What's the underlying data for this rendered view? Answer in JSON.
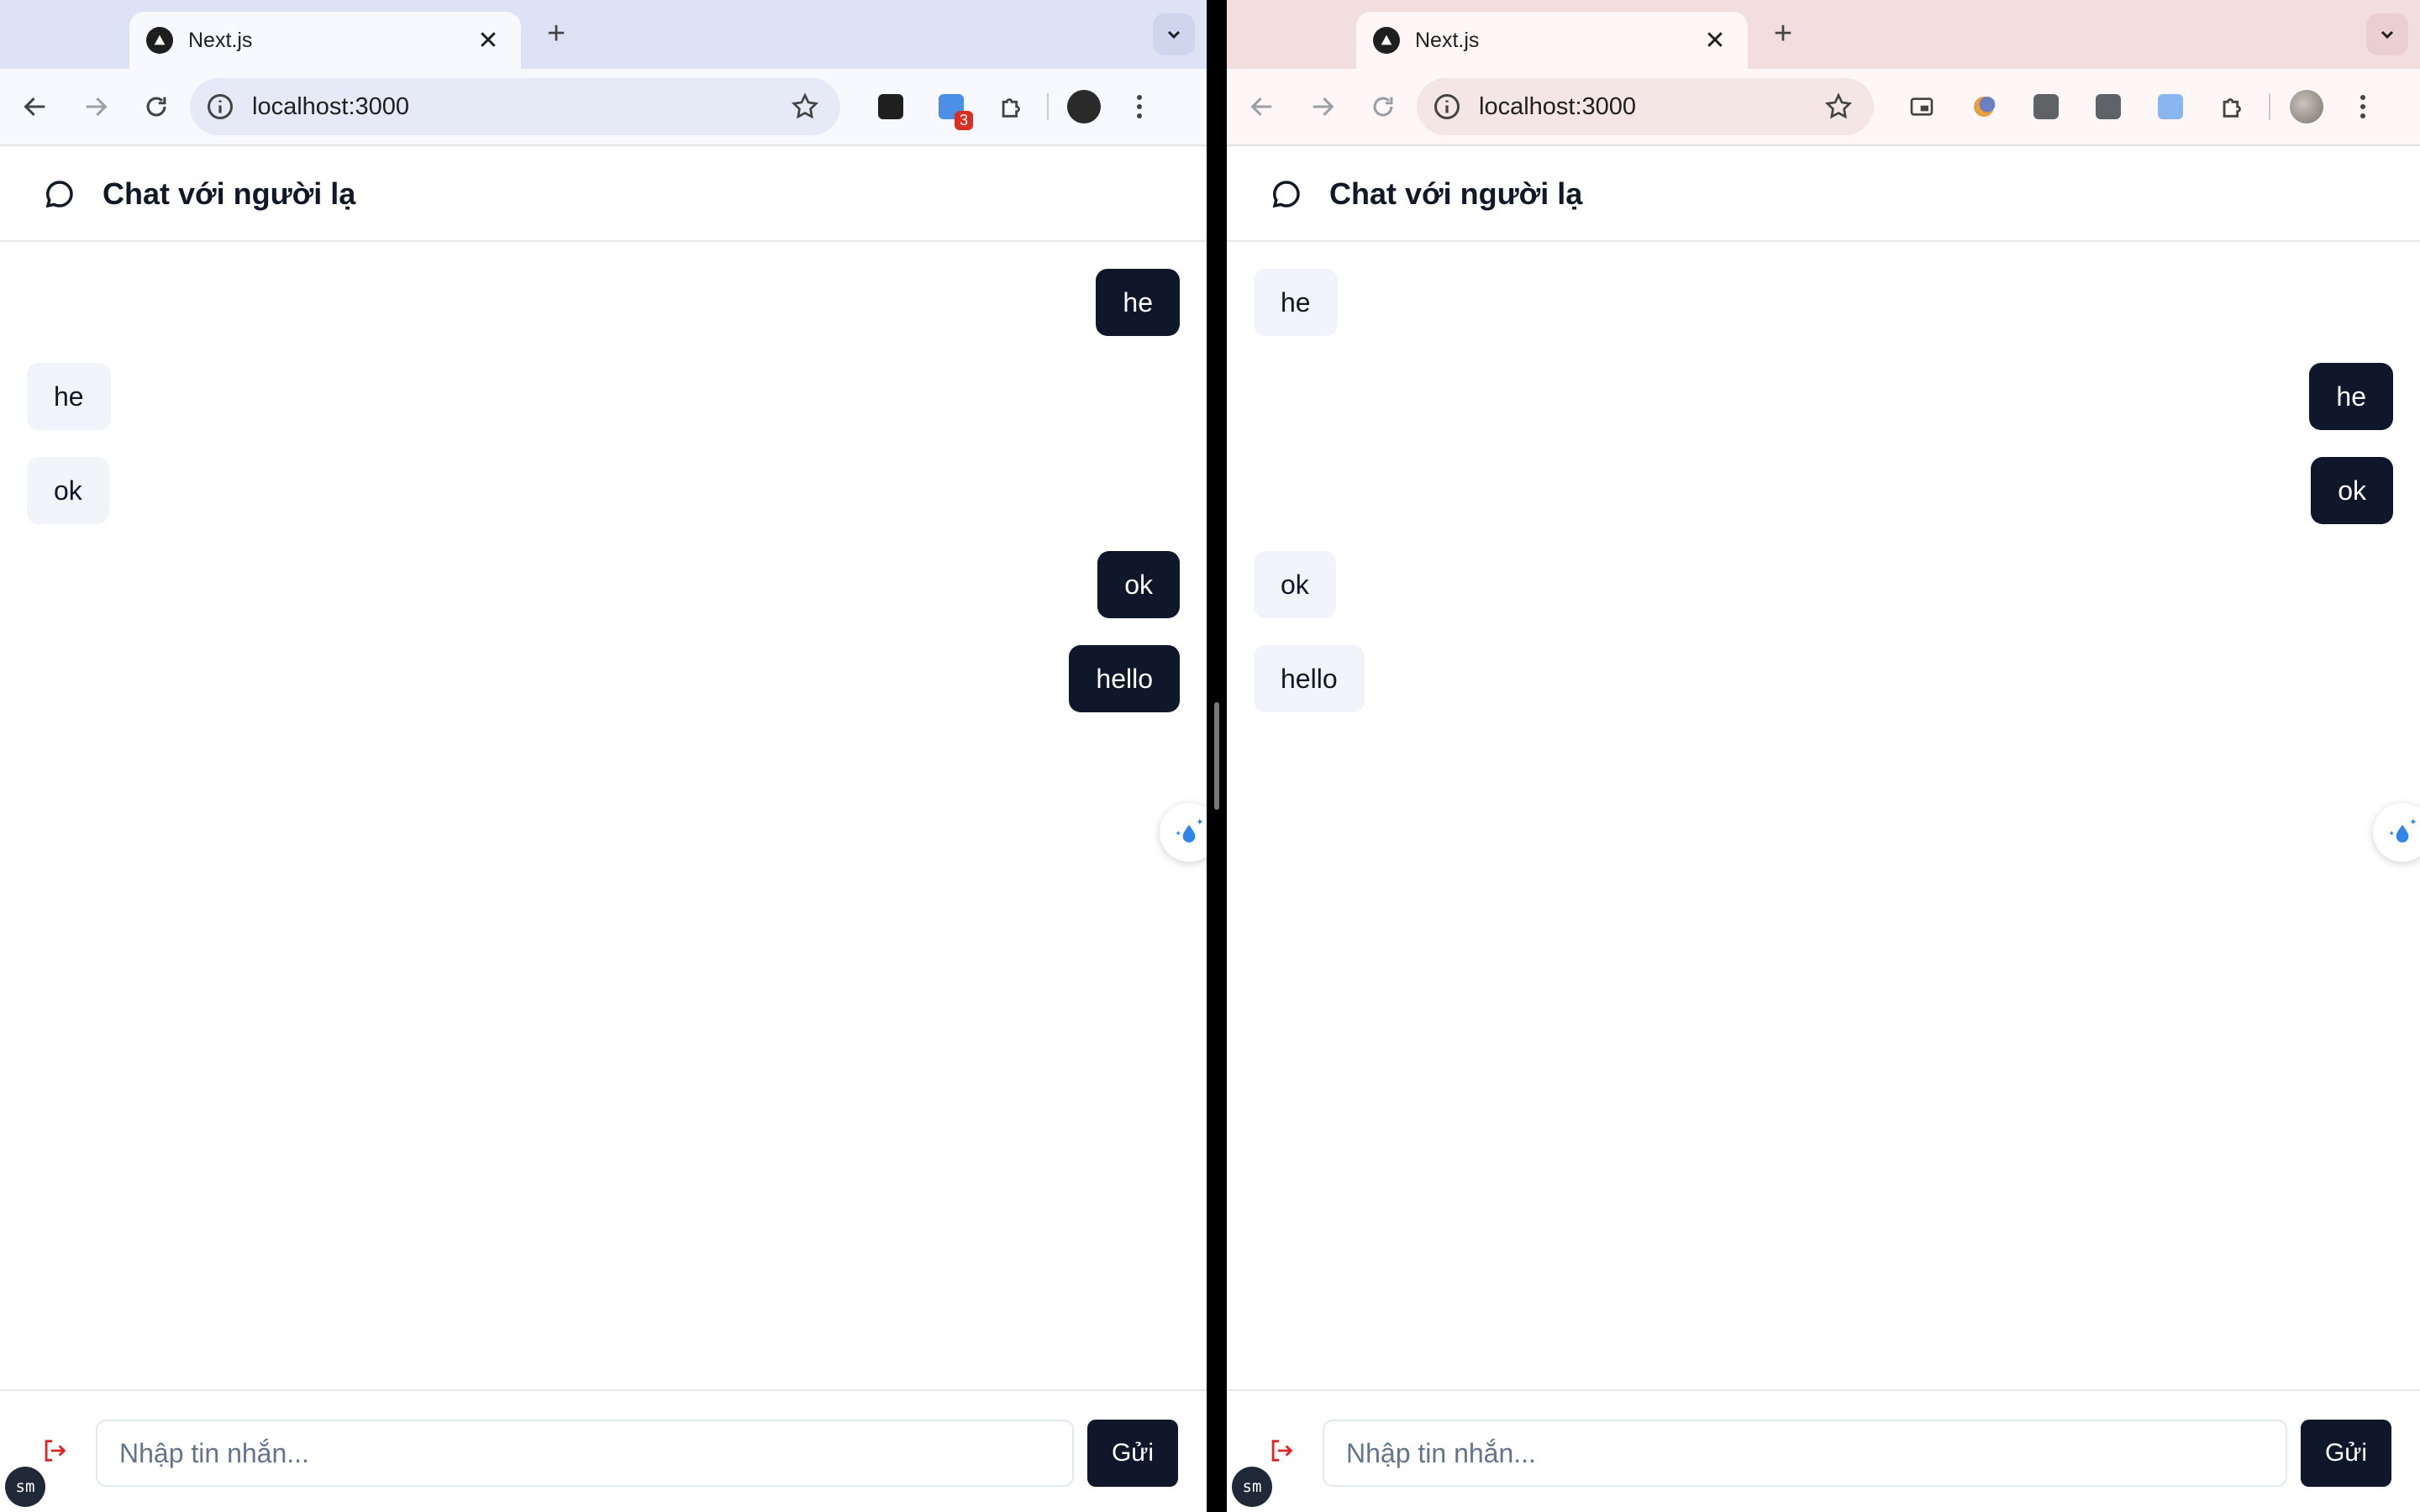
{
  "colors": {
    "bubble_mine": "#0f172a",
    "bubble_theirs": "#f1f5f9",
    "send_button": "#0f172a",
    "logout_icon": "#dc2626",
    "fab_drop": "#2f86e8",
    "left_frame": "#dde3f5",
    "right_frame": "#f2dedf"
  },
  "left": {
    "tab": {
      "title": "Next.js",
      "favicon": "nextjs-icon",
      "close_glyph": "✕"
    },
    "new_tab_glyph": "+",
    "address": {
      "url": "localhost:3000"
    },
    "extensions": [
      "nextjs-ext-icon",
      "extension-badge-icon",
      "puzzle-icon",
      "cat-avatar-icon"
    ],
    "extension_badge_count": "3",
    "header": {
      "title": "Chat với người lạ"
    },
    "messages": [
      {
        "text": "he",
        "side": "mine"
      },
      {
        "text": "he",
        "side": "theirs"
      },
      {
        "text": "ok",
        "side": "theirs"
      },
      {
        "text": "ok",
        "side": "mine"
      },
      {
        "text": "hello",
        "side": "mine"
      }
    ],
    "composer": {
      "placeholder": "Nhập tin nhắn...",
      "send_label": "Gửi",
      "avatar_initials": "sm"
    }
  },
  "right": {
    "tab": {
      "title": "Next.js",
      "favicon": "nextjs-icon",
      "close_glyph": "✕"
    },
    "new_tab_glyph": "+",
    "address": {
      "url": "localhost:3000"
    },
    "extensions": [
      "pip-icon",
      "moon-ext-icon",
      "ext-gray-icon",
      "ext-gray-icon",
      "drop-ext-icon",
      "puzzle-icon",
      "profile-avatar-icon"
    ],
    "header": {
      "title": "Chat với người lạ"
    },
    "messages": [
      {
        "text": "he",
        "side": "theirs"
      },
      {
        "text": "he",
        "side": "mine"
      },
      {
        "text": "ok",
        "side": "mine"
      },
      {
        "text": "ok",
        "side": "theirs"
      },
      {
        "text": "hello",
        "side": "theirs"
      }
    ],
    "composer": {
      "placeholder": "Nhập tin nhắn...",
      "send_label": "Gửi",
      "avatar_initials": "sm"
    }
  }
}
